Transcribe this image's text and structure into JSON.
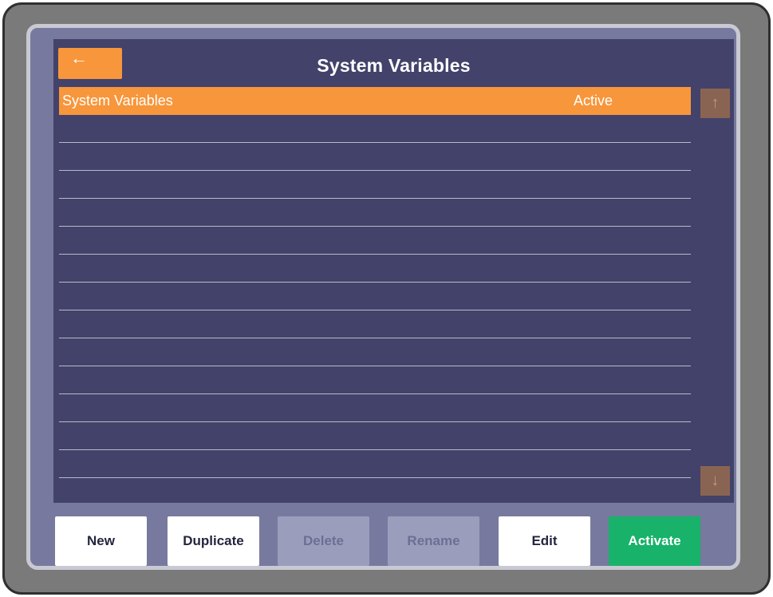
{
  "header": {
    "title": "System Variables",
    "back_icon": "arrow-left-icon",
    "back_glyph": "←"
  },
  "list": {
    "rows": [
      {
        "name": "System Variables",
        "status": "Active",
        "selected": true
      }
    ],
    "empty_rows": 13
  },
  "scroll": {
    "up_icon": "arrow-up-icon",
    "up_glyph": "↑",
    "down_icon": "arrow-down-icon",
    "down_glyph": "↓"
  },
  "buttons": {
    "new": "New",
    "duplicate": "Duplicate",
    "delete": "Delete",
    "rename": "Rename",
    "edit": "Edit",
    "activate": "Activate"
  },
  "colors": {
    "accent": "#f7963b",
    "screen_bg": "#43426a",
    "activate": "#18b26a",
    "disabled": "#9b9dbd"
  }
}
